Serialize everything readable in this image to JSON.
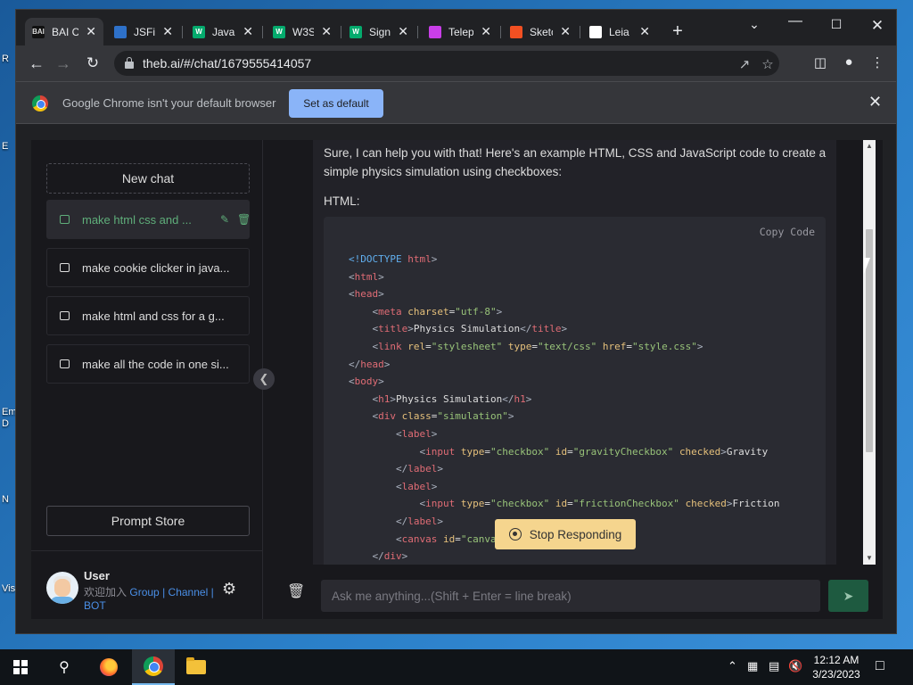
{
  "desktop": {
    "labels": [
      "R",
      "E",
      "Em\nD",
      "N",
      "Vis"
    ]
  },
  "tabs": [
    {
      "title": "BAI C",
      "favicon_color": "#111111",
      "favicon_text": "BAI",
      "active": true
    },
    {
      "title": "JSFid",
      "favicon_color": "#2e71c9",
      "favicon_text": "",
      "active": false
    },
    {
      "title": "Java",
      "favicon_color": "#04aa6d",
      "favicon_text": "W",
      "active": false
    },
    {
      "title": "W3S",
      "favicon_color": "#04aa6d",
      "favicon_text": "W",
      "active": false
    },
    {
      "title": "Sign",
      "favicon_color": "#04aa6d",
      "favicon_text": "W",
      "active": false
    },
    {
      "title": "Telep",
      "favicon_color": "#c93ee8",
      "favicon_text": "",
      "active": false
    },
    {
      "title": "Sketc",
      "favicon_color": "#f25022",
      "favicon_text": "",
      "active": false
    },
    {
      "title": "Leia",
      "favicon_color": "#ffffff",
      "favicon_text": "",
      "active": false
    }
  ],
  "browser": {
    "url": "theb.ai/#/chat/1679555414057",
    "infobar_text": "Google Chrome isn't your default browser",
    "set_default_label": "Set as default"
  },
  "sidebar": {
    "new_chat_label": "New chat",
    "chats": [
      {
        "title": "make html css and ...",
        "active": true
      },
      {
        "title": "make cookie clicker in java...",
        "active": false
      },
      {
        "title": "make html and css for a g...",
        "active": false
      },
      {
        "title": "make all the code in one si...",
        "active": false
      }
    ],
    "prompt_store_label": "Prompt Store",
    "user": {
      "name": "User",
      "sub_prefix": "欢迎加入",
      "link_group": "Group",
      "sep": "|",
      "link_channel": "Channel",
      "link_bot": "BOT"
    }
  },
  "chat": {
    "message_intro": "Sure, I can help you with that! Here's an example HTML, CSS and JavaScript code to create a simple physics simulation using checkboxes:",
    "html_label": "HTML:",
    "copy_code_label": "Copy  Code",
    "stop_label": "Stop Responding",
    "input_placeholder": "Ask me anything...(Shift + Enter = line break)"
  },
  "taskbar": {
    "time": "12:12 AM",
    "date": "3/23/2023"
  },
  "colors": {
    "accent_green": "#5fae7a",
    "link_blue": "#4a8fe7",
    "stop_button": "#f5d58e",
    "send_button": "#1e5a40"
  }
}
